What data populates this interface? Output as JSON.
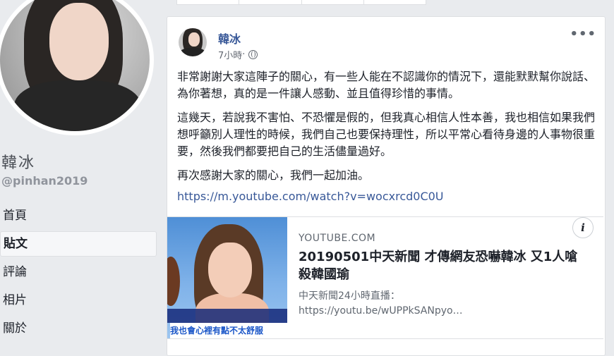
{
  "profile": {
    "name": "韓冰",
    "handle": "@pinhan2019",
    "nav_items": [
      {
        "label": "首頁",
        "active": false
      },
      {
        "label": "貼文",
        "active": true
      },
      {
        "label": "評論",
        "active": false
      },
      {
        "label": "相片",
        "active": false
      },
      {
        "label": "關於",
        "active": false
      }
    ]
  },
  "post": {
    "author": "韓冰",
    "time": "7小時",
    "separator": " · ",
    "menu_icon": "more-horizontal-icon",
    "paragraphs": [
      "非常謝謝大家這陣子的關心，有一些人能在不認識你的情況下，還能默默幫你說話、為你著想，真的是一件讓人感動、並且值得珍惜的事情。",
      "這幾天，若說我不害怕、不恐懼是假的，但我真心相信人性本善，我也相信如果我們想呼籲別人理性的時候，我們自己也要保持理性，所以平常心看待身邊的人事物很重要，然後我們都要把自己的生活儘量過好。",
      "再次感謝大家的關心，我們一起加油。"
    ],
    "link": "https://m.youtube.com/watch?v=wocxrcd0C0U"
  },
  "preview": {
    "domain": "YOUTUBE.COM",
    "title": "20190501中天新聞 才傳網友恐嚇韓冰 又1人嗆殺韓國瑜",
    "desc_line1": "中天新聞24小時直播：",
    "desc_line2": "https://youtu.be/wUPPkSANpyo…",
    "thumb_caption": "我也會心裡有點不太舒服",
    "info_icon": "i"
  },
  "colors": {
    "link": "#385898",
    "background": "#e9ebee",
    "muted": "#606770"
  }
}
